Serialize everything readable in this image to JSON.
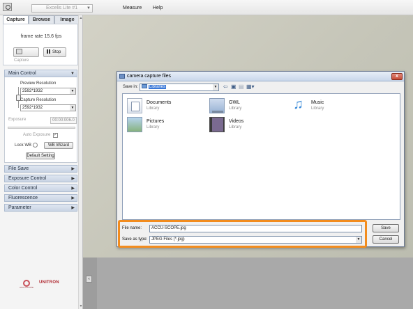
{
  "topbar": {
    "device": "Excelis Lite #1",
    "menu": [
      "Measure",
      "Help"
    ]
  },
  "left_panel": {
    "tabs": [
      "Capture",
      "Browse",
      "Image"
    ],
    "active_tab": "Capture",
    "frame_rate": "frame rate 15.6 fps",
    "capture_label": "Capture",
    "stop_label": "Stop",
    "main_control": {
      "title": "Main Control",
      "preview_resolution_label": "Preview Resolution",
      "preview_resolution_value": "2592*1932",
      "capture_resolution_label": "Capture Resolution",
      "capture_resolution_value": "2592*1932",
      "exposure_label": "Exposure",
      "exposure_value": "00:00:006.0",
      "auto_exposure_label": "Auto Exposure",
      "auto_exposure_checked": true,
      "lock_wb_label": "Lock WB",
      "wb_wizard_label": "WB Wizard",
      "default_setting_label": "Default Setting"
    },
    "sections": [
      "File Save",
      "Exposure Control",
      "Color Control",
      "Fluorescence",
      "Parameter"
    ],
    "logos": [
      "ACCU-SCOPE",
      "UNITRON"
    ]
  },
  "dialog": {
    "title": "camera capture files",
    "save_in_label": "Save in:",
    "save_in_value": "Libraries",
    "items": [
      {
        "name": "Documents",
        "type": "Library",
        "icon": "documents-icon"
      },
      {
        "name": "GWL",
        "type": "Library",
        "icon": "gwl-icon"
      },
      {
        "name": "Music",
        "type": "Library",
        "icon": "music-icon"
      },
      {
        "name": "Pictures",
        "type": "Library",
        "icon": "pictures-icon"
      },
      {
        "name": "Videos",
        "type": "Library",
        "icon": "videos-icon"
      }
    ],
    "file_name_label": "File name:",
    "file_name_value": "ACCU-SCOPE.jpg",
    "save_as_type_label": "Save as type:",
    "save_as_type_value": "JPEG Files (*.jpg)",
    "save_button": "Save",
    "cancel_button": "Cancel",
    "close_symbol": "x"
  },
  "colors": {
    "highlight": "#f28c1e",
    "section_header": "#c9d4e4",
    "preview_bg": "#c8c7ba"
  }
}
